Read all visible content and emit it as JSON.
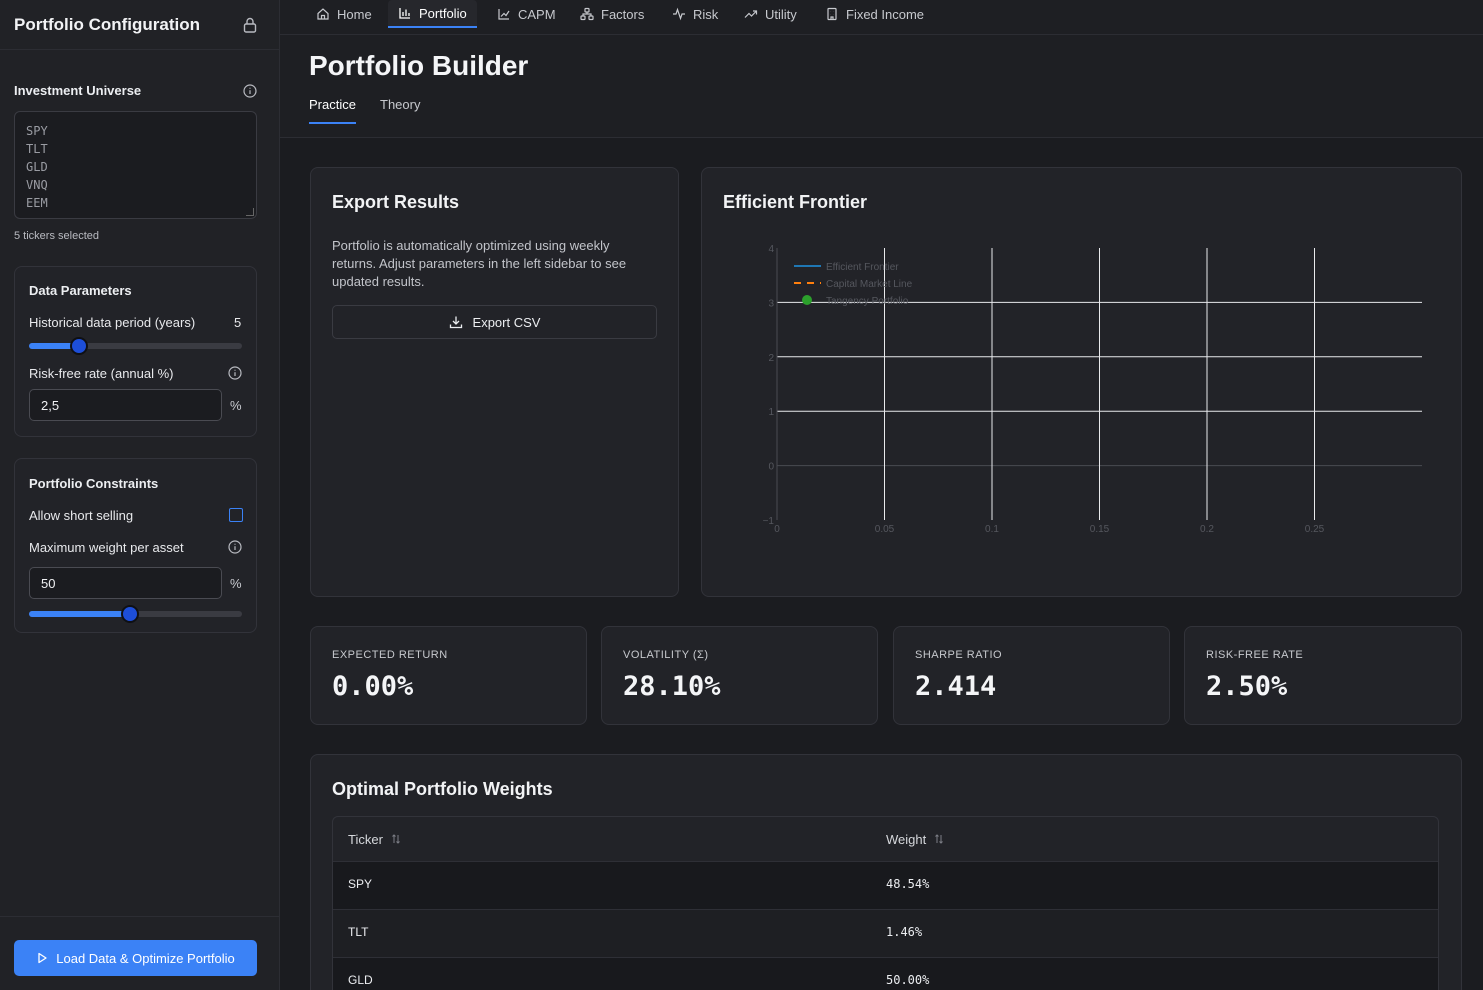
{
  "sidebar": {
    "title": "Portfolio Configuration",
    "universe_label": "Investment Universe",
    "tickers_text": "SPY\nTLT\nGLD\nVNQ\nEEM",
    "tickers_note": "5 tickers selected",
    "data_params": {
      "title": "Data Parameters",
      "period_label": "Historical data period (years)",
      "period_value": "5",
      "period_fraction": 0.235,
      "rf_label": "Risk-free rate (annual %)",
      "rf_value": "2,5",
      "rf_unit": "%"
    },
    "constraints": {
      "title": "Portfolio Constraints",
      "short_label": "Allow short selling",
      "short_checked": false,
      "maxw_label": "Maximum weight per asset",
      "maxw_value": "50",
      "maxw_unit": "%",
      "maxw_fraction": 0.475
    },
    "run_label": "Load Data & Optimize Portfolio"
  },
  "nav": {
    "items": [
      {
        "label": "Home",
        "icon": "home-icon"
      },
      {
        "label": "Portfolio",
        "icon": "bar-chart-icon",
        "active": true
      },
      {
        "label": "CAPM",
        "icon": "line-chart-icon"
      },
      {
        "label": "Factors",
        "icon": "factors-icon"
      },
      {
        "label": "Risk",
        "icon": "pulse-icon"
      },
      {
        "label": "Utility",
        "icon": "trending-up-icon"
      },
      {
        "label": "Fixed Income",
        "icon": "building-icon"
      }
    ]
  },
  "page": {
    "title": "Portfolio Builder",
    "tabs": [
      "Practice",
      "Theory"
    ]
  },
  "export": {
    "title": "Export Results",
    "description": "Portfolio is automatically optimized using weekly returns. Adjust parameters in the left sidebar to see updated results.",
    "button_label": "Export CSV"
  },
  "frontier": {
    "title": "Efficient Frontier"
  },
  "chart_data": {
    "type": "line",
    "title": "Efficient Frontier",
    "x_ticks": [
      "0",
      "0.05",
      "0.1",
      "0.15",
      "0.2",
      "0.25"
    ],
    "y_ticks": [
      "4",
      "3",
      "2",
      "1",
      "0",
      "−1"
    ],
    "xlim": [
      0,
      0.3
    ],
    "ylim": [
      -1,
      4
    ],
    "grid": true,
    "legend_position": "top-left",
    "series": [
      {
        "name": "Efficient Frontier",
        "style": "solid",
        "color": "#1f77b4",
        "values": []
      },
      {
        "name": "Capital Market Line",
        "style": "dashed",
        "color": "#ff7f0e",
        "values": []
      },
      {
        "name": "Tangency Portfolio",
        "style": "marker",
        "color": "#2ca02c",
        "values": []
      }
    ]
  },
  "metrics": [
    {
      "label": "EXPECTED RETURN",
      "value": "0.00%"
    },
    {
      "label": "VOLATILITY (Σ)",
      "value": "28.10%"
    },
    {
      "label": "SHARPE RATIO",
      "value": "2.414"
    },
    {
      "label": "RISK-FREE RATE",
      "value": "2.50%"
    }
  ],
  "weights": {
    "title": "Optimal Portfolio Weights",
    "columns": [
      "Ticker",
      "Weight"
    ],
    "rows": [
      {
        "ticker": "SPY",
        "weight": "48.54%"
      },
      {
        "ticker": "TLT",
        "weight": "1.46%"
      },
      {
        "ticker": "GLD",
        "weight": "50.00%"
      }
    ]
  },
  "colors": {
    "accent": "#3b82f6",
    "background": "#1b1c20",
    "card": "#222328"
  }
}
